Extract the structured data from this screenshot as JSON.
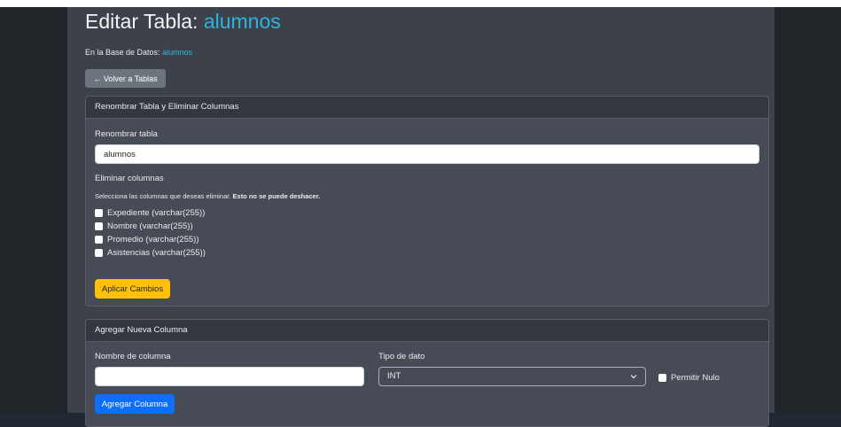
{
  "page": {
    "title_prefix": "Editar Tabla: ",
    "table_name": "alumnos",
    "db_label": "En la Base de Datos: ",
    "db_name": "alumnos",
    "back_label": "← Volver a Tablas"
  },
  "rename_card": {
    "header": "Renombrar Tabla y Eliminar Columnas",
    "rename_label": "Renombrar tabla",
    "rename_value": "alumnos",
    "delete_label": "Eliminar columnas",
    "delete_hint": "Selecciona las columnas que deseas eliminar. ",
    "delete_warning": "Esto no se puede deshacer.",
    "columns": [
      {
        "label": "Expediente (varchar(255))"
      },
      {
        "label": "Nombre (varchar(255))"
      },
      {
        "label": "Promedio (varchar(255))"
      },
      {
        "label": "Asistencias (varchar(255))"
      }
    ],
    "apply_label": "Aplicar Cambios"
  },
  "add_card": {
    "header": "Agregar Nueva Columna",
    "name_label": "Nombre de columna",
    "name_value": "",
    "type_label": "Tipo de dato",
    "type_value": "INT",
    "nullable_label": "Permitir Nulo",
    "add_label": "Agregar Columna"
  },
  "colors": {
    "accent": "#2cb5e0",
    "warning": "#ffc107",
    "primary": "#0d6efd",
    "secondary": "#6c757d"
  }
}
